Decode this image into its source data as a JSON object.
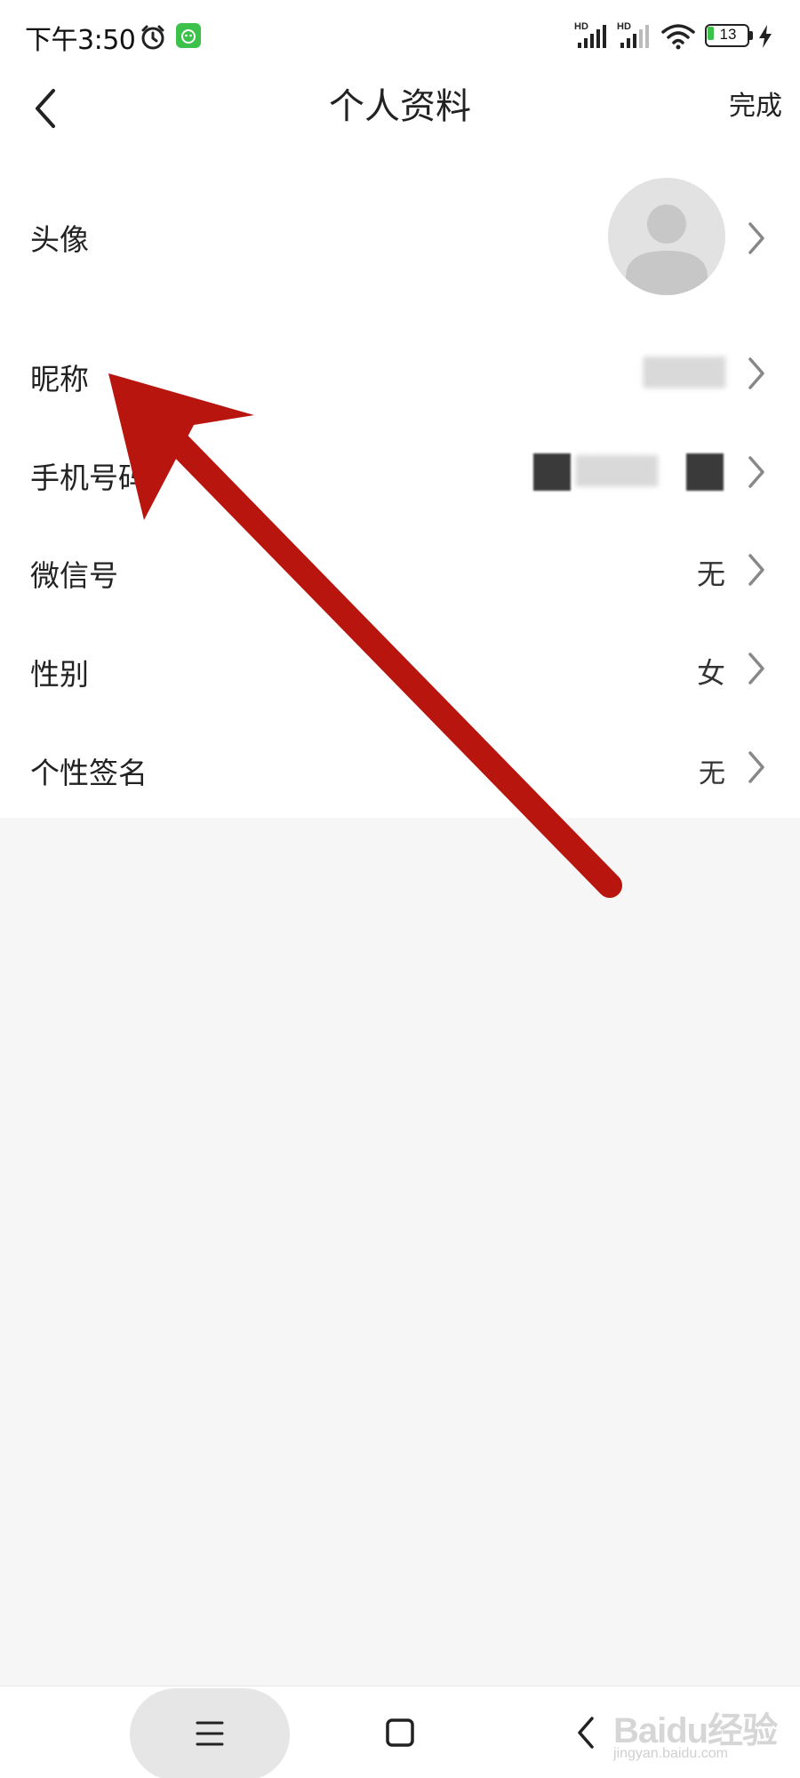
{
  "status_bar": {
    "time": "下午3:50",
    "battery_level": "13",
    "network_labels": [
      "HD",
      "HD"
    ]
  },
  "header": {
    "title": "个人资料",
    "done_label": "完成"
  },
  "profile": {
    "avatar_label": "头像",
    "nickname_label": "昵称",
    "phone_label": "手机号码",
    "wechat_label": "微信号",
    "wechat_value": "无",
    "gender_label": "性别",
    "gender_value": "女",
    "signature_label": "个性签名",
    "signature_value": "无"
  },
  "watermark": {
    "main": "Baidu经验",
    "sub": "jingyan.baidu.com"
  },
  "colors": {
    "arrow": "#c01818",
    "background": "#f6f6f6",
    "battery_fill": "#3cc14a",
    "app_badge": "#3cc14a"
  }
}
